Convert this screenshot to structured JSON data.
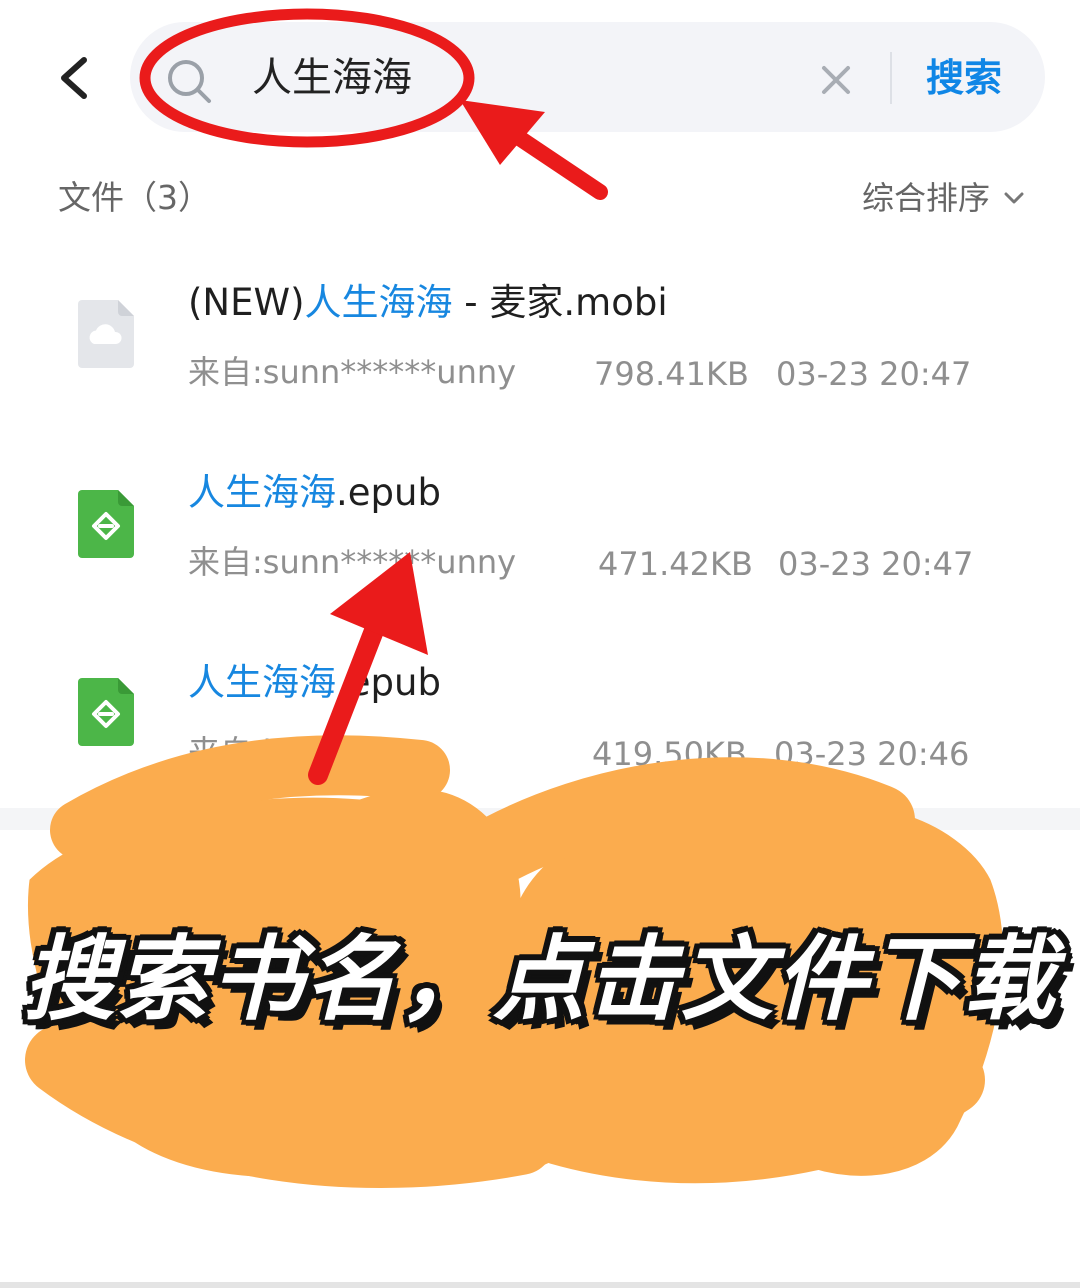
{
  "search": {
    "query": "人生海海",
    "button_label": "搜索"
  },
  "section": {
    "title": "文件（3）",
    "sort_label": "综合排序"
  },
  "files": [
    {
      "name_prefix": "(NEW)",
      "name_highlight": "人生海海",
      "name_suffix": " - 麦家.mobi",
      "source": "来自:sunn******unny",
      "size": "798.41KB",
      "time": "03-23 20:47",
      "icon": "cloud-file-icon"
    },
    {
      "name_prefix": "",
      "name_highlight": "人生海海",
      "name_suffix": ".epub",
      "source": "来自:sunn******unny",
      "size": "471.42KB",
      "time": "03-23 20:47",
      "icon": "epub-file-icon"
    },
    {
      "name_prefix": "",
      "name_highlight": "人生海海",
      "name_suffix": ".epub",
      "source": "来自:be***bei",
      "size": "419.50KB",
      "time": "03-23 20:46",
      "icon": "epub-file-icon"
    }
  ],
  "caption": "搜索书名，点击文件下载",
  "colors": {
    "accent": "#1787e0",
    "annotation_red": "#ea1b1b",
    "annotation_orange": "#fbac4e",
    "epub_green": "#4cb648"
  }
}
